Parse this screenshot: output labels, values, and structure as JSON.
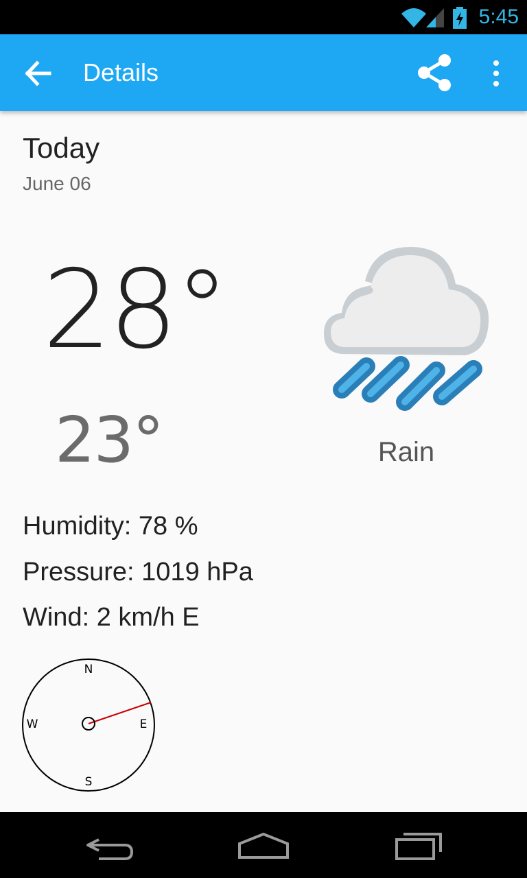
{
  "status_bar": {
    "time": "5:45",
    "icons": [
      "wifi-icon",
      "cell-signal-icon",
      "battery-charging-icon"
    ],
    "accent_color": "#33B5E5"
  },
  "app_bar": {
    "title": "Details",
    "background_color": "#1EA8F4",
    "actions": [
      "back-arrow-icon",
      "share-icon",
      "overflow-menu-icon"
    ]
  },
  "forecast": {
    "day": "Today",
    "date": "June 06",
    "high": "28°",
    "low": "23°",
    "condition": "Rain",
    "condition_icon": "rain-cloud-icon",
    "humidity": "Humidity: 78 %",
    "pressure": "Pressure: 1019 hPa",
    "wind": "Wind: 2 km/h E"
  },
  "compass": {
    "labels": {
      "n": "N",
      "s": "S",
      "w": "W",
      "e": "E"
    },
    "needle_color": "#CC0000"
  },
  "nav_bar": {
    "buttons": [
      "back-nav-icon",
      "home-nav-icon",
      "recents-nav-icon"
    ]
  }
}
